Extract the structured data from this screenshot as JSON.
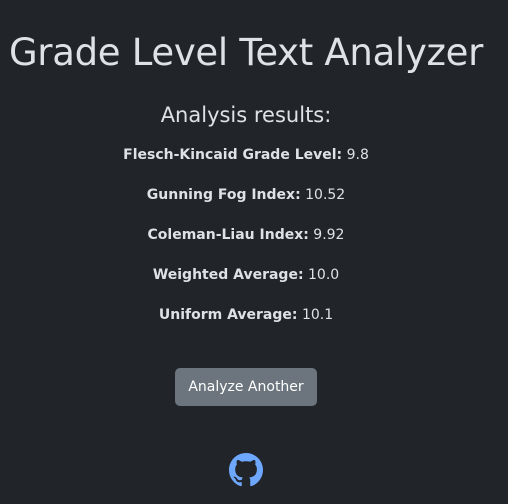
{
  "header": {
    "title": "Grade Level Text Analyzer"
  },
  "results": {
    "heading": "Analysis results:",
    "metrics": [
      {
        "label": "Flesch-Kincaid Grade Level:",
        "value": "9.8"
      },
      {
        "label": "Gunning Fog Index:",
        "value": "10.52"
      },
      {
        "label": "Coleman-Liau Index:",
        "value": "9.92"
      },
      {
        "label": "Weighted Average:",
        "value": "10.0"
      },
      {
        "label": "Uniform Average:",
        "value": "10.1"
      }
    ]
  },
  "actions": {
    "analyze_another_label": "Analyze Another"
  },
  "footer": {
    "github_icon": "github-icon"
  },
  "colors": {
    "background": "#212529",
    "text": "#dee2e6",
    "button": "#6c757d",
    "link": "#6ea8fe"
  }
}
